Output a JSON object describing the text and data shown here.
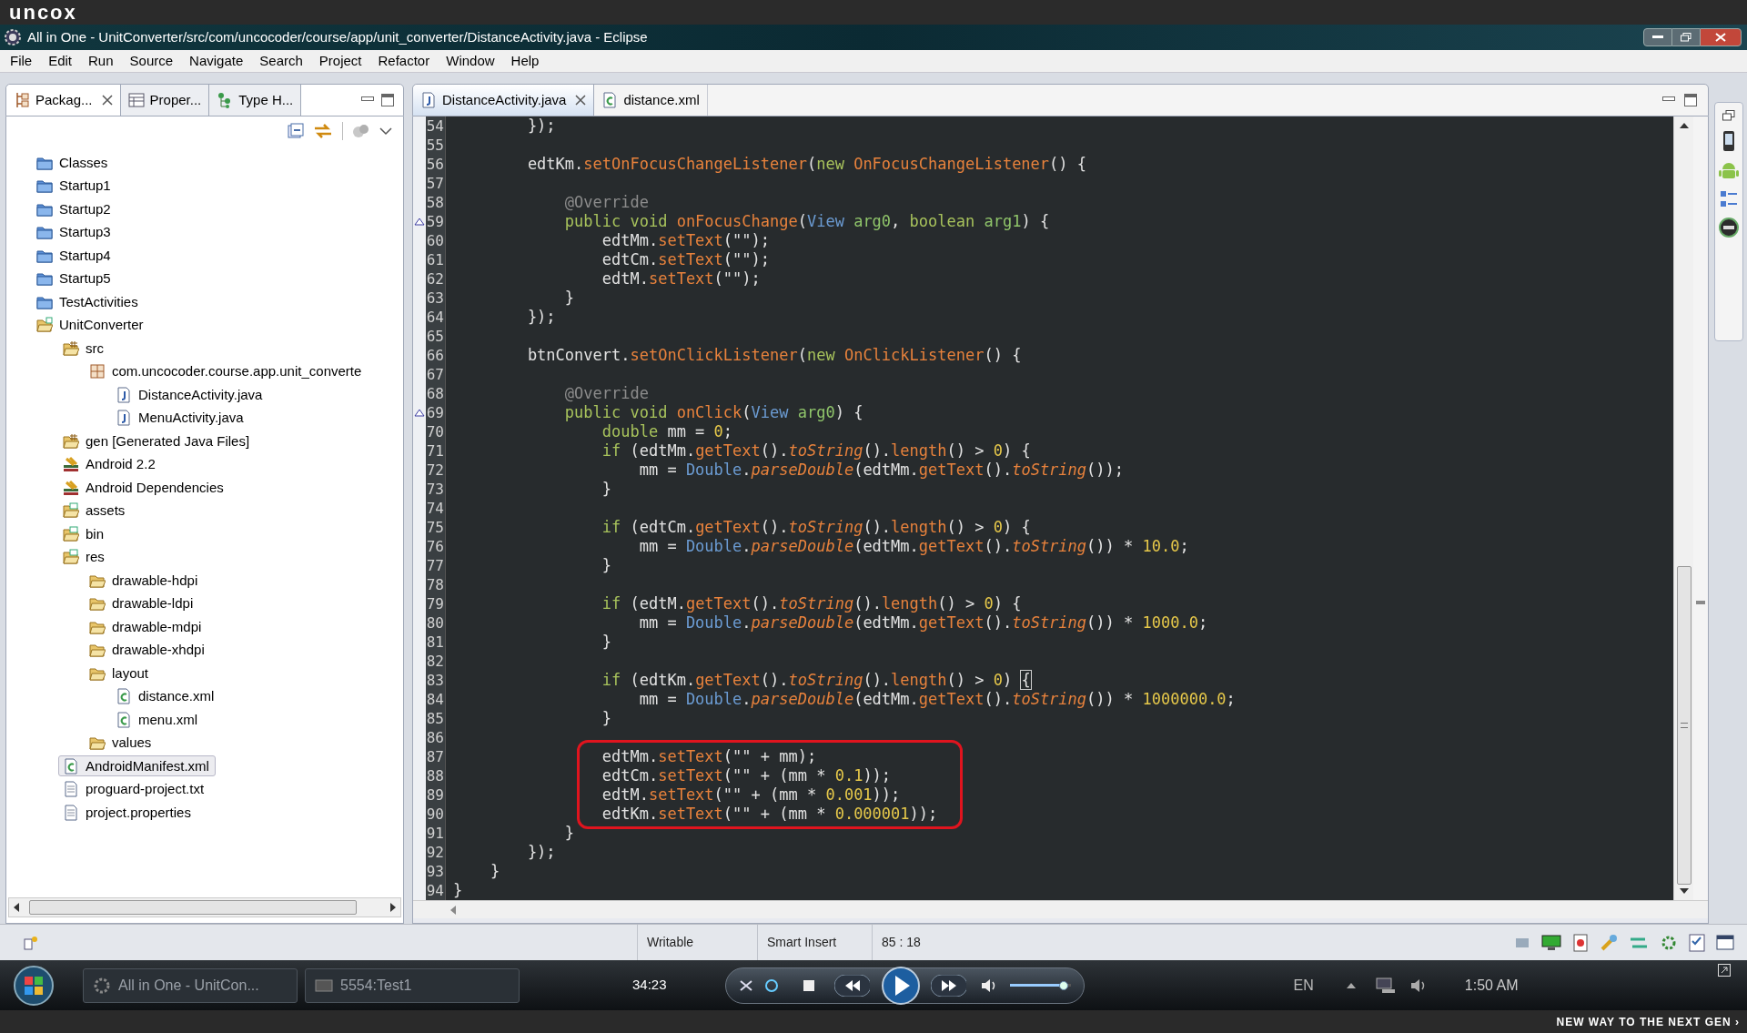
{
  "frame_logo": "uncox",
  "window": {
    "title": "All in One - UnitConverter/src/com/uncocoder/course/app/unit_converter/DistanceActivity.java - Eclipse"
  },
  "menu": [
    "File",
    "Edit",
    "Run",
    "Source",
    "Navigate",
    "Search",
    "Project",
    "Refactor",
    "Window",
    "Help"
  ],
  "view_tabs": [
    {
      "label": "Packag...",
      "kind": "package-explorer",
      "selected": true
    },
    {
      "label": "Proper...",
      "kind": "properties",
      "selected": false
    },
    {
      "label": "Type H...",
      "kind": "hierarchy",
      "selected": false
    }
  ],
  "tree": [
    {
      "label": "Classes",
      "kind": "project-closed",
      "selected": false
    },
    {
      "label": "Startup1",
      "kind": "project-closed",
      "selected": false
    },
    {
      "label": "Startup2",
      "kind": "project-closed",
      "selected": false
    },
    {
      "label": "Startup3",
      "kind": "project-closed",
      "selected": false
    },
    {
      "label": "Startup4",
      "kind": "project-closed",
      "selected": false
    },
    {
      "label": "Startup5",
      "kind": "project-closed",
      "selected": false
    },
    {
      "label": "TestActivities",
      "kind": "project-closed",
      "selected": false
    },
    {
      "label": "UnitConverter",
      "kind": "project-open",
      "selected": false,
      "children": [
        {
          "label": "src",
          "kind": "source-folder",
          "selected": false,
          "children": [
            {
              "label": "com.uncocoder.course.app.unit_converte",
              "kind": "package",
              "selected": false,
              "children": [
                {
                  "label": "DistanceActivity.java",
                  "kind": "java-file",
                  "selected": false
                },
                {
                  "label": "MenuActivity.java",
                  "kind": "java-file",
                  "selected": false
                }
              ]
            }
          ]
        },
        {
          "label": "gen [Generated Java Files]",
          "kind": "source-folder",
          "selected": false
        },
        {
          "label": "Android 2.2",
          "kind": "library",
          "selected": false
        },
        {
          "label": "Android Dependencies",
          "kind": "library",
          "selected": false
        },
        {
          "label": "assets",
          "kind": "resource-folder",
          "selected": false
        },
        {
          "label": "bin",
          "kind": "resource-folder",
          "selected": false
        },
        {
          "label": "res",
          "kind": "resource-folder",
          "selected": false,
          "children": [
            {
              "label": "drawable-hdpi",
              "kind": "folder",
              "selected": false
            },
            {
              "label": "drawable-ldpi",
              "kind": "folder",
              "selected": false
            },
            {
              "label": "drawable-mdpi",
              "kind": "folder",
              "selected": false
            },
            {
              "label": "drawable-xhdpi",
              "kind": "folder",
              "selected": false
            },
            {
              "label": "layout",
              "kind": "folder",
              "selected": false,
              "children": [
                {
                  "label": "distance.xml",
                  "kind": "xml-file",
                  "selected": false
                },
                {
                  "label": "menu.xml",
                  "kind": "xml-file",
                  "selected": false
                }
              ]
            },
            {
              "label": "values",
              "kind": "folder",
              "selected": false
            }
          ]
        },
        {
          "label": "AndroidManifest.xml",
          "kind": "xml-file",
          "selected": true
        },
        {
          "label": "proguard-project.txt",
          "kind": "text-file",
          "selected": false
        },
        {
          "label": "project.properties",
          "kind": "text-file",
          "selected": false
        }
      ]
    }
  ],
  "editor_tabs": [
    {
      "label": "DistanceActivity.java",
      "kind": "java-file",
      "selected": true
    },
    {
      "label": "distance.xml",
      "kind": "xml-file",
      "selected": false
    }
  ],
  "code_lines": [
    {
      "number": "54",
      "override_marker": false,
      "highlighted": false,
      "tokens": [
        {
          "kind": "plain",
          "text": "        });"
        }
      ]
    },
    {
      "number": "55",
      "override_marker": false,
      "highlighted": false
    },
    {
      "number": "56",
      "override_marker": false,
      "highlighted": false,
      "tokens": [
        {
          "kind": "plain",
          "text": "        edtKm."
        },
        {
          "kind": "method",
          "text": "setOnFocusChangeListener"
        },
        {
          "kind": "plain",
          "text": "("
        },
        {
          "kind": "keyword",
          "text": "new "
        },
        {
          "kind": "method",
          "text": "OnFocusChangeListener"
        },
        {
          "kind": "plain",
          "text": "() {"
        }
      ]
    },
    {
      "number": "57",
      "override_marker": false,
      "highlighted": false
    },
    {
      "number": "58",
      "override_marker": false,
      "highlighted": false,
      "tokens": [
        {
          "kind": "annotation",
          "text": "            @Override"
        }
      ]
    },
    {
      "number": "59",
      "override_marker": true,
      "highlighted": false,
      "tokens": [
        {
          "kind": "keyword",
          "text": "            public void "
        },
        {
          "kind": "method",
          "text": "onFocusChange"
        },
        {
          "kind": "plain",
          "text": "("
        },
        {
          "kind": "type",
          "text": "View"
        },
        {
          "kind": "param",
          "text": " arg0"
        },
        {
          "kind": "plain",
          "text": ", "
        },
        {
          "kind": "keyword",
          "text": "boolean"
        },
        {
          "kind": "param",
          "text": " arg1"
        },
        {
          "kind": "plain",
          "text": ") {"
        }
      ]
    },
    {
      "number": "60",
      "override_marker": false,
      "highlighted": false,
      "tokens": [
        {
          "kind": "plain",
          "text": "                edtMm."
        },
        {
          "kind": "method",
          "text": "setText"
        },
        {
          "kind": "plain",
          "text": "(\"\");"
        }
      ]
    },
    {
      "number": "61",
      "override_marker": false,
      "highlighted": false,
      "tokens": [
        {
          "kind": "plain",
          "text": "                edtCm."
        },
        {
          "kind": "method",
          "text": "setText"
        },
        {
          "kind": "plain",
          "text": "(\"\");"
        }
      ]
    },
    {
      "number": "62",
      "override_marker": false,
      "highlighted": false,
      "tokens": [
        {
          "kind": "plain",
          "text": "                edtM."
        },
        {
          "kind": "method",
          "text": "setText"
        },
        {
          "kind": "plain",
          "text": "(\"\");"
        }
      ]
    },
    {
      "number": "63",
      "override_marker": false,
      "highlighted": false,
      "tokens": [
        {
          "kind": "plain",
          "text": "            }"
        }
      ]
    },
    {
      "number": "64",
      "override_marker": false,
      "highlighted": false,
      "tokens": [
        {
          "kind": "plain",
          "text": "        });"
        }
      ]
    },
    {
      "number": "65",
      "override_marker": false,
      "highlighted": false
    },
    {
      "number": "66",
      "override_marker": false,
      "highlighted": false,
      "tokens": [
        {
          "kind": "plain",
          "text": "        btnConvert."
        },
        {
          "kind": "method",
          "text": "setOnClickListener"
        },
        {
          "kind": "plain",
          "text": "("
        },
        {
          "kind": "keyword",
          "text": "new "
        },
        {
          "kind": "method",
          "text": "OnClickListener"
        },
        {
          "kind": "plain",
          "text": "() {"
        }
      ]
    },
    {
      "number": "67",
      "override_marker": false,
      "highlighted": false
    },
    {
      "number": "68",
      "override_marker": false,
      "highlighted": false,
      "tokens": [
        {
          "kind": "annotation",
          "text": "            @Override"
        }
      ]
    },
    {
      "number": "69",
      "override_marker": true,
      "highlighted": false,
      "tokens": [
        {
          "kind": "keyword",
          "text": "            public void "
        },
        {
          "kind": "method",
          "text": "onClick"
        },
        {
          "kind": "plain",
          "text": "("
        },
        {
          "kind": "type",
          "text": "View"
        },
        {
          "kind": "param",
          "text": " arg0"
        },
        {
          "kind": "plain",
          "text": ") {"
        }
      ]
    },
    {
      "number": "70",
      "override_marker": false,
      "highlighted": false,
      "tokens": [
        {
          "kind": "keyword",
          "text": "                double"
        },
        {
          "kind": "plain",
          "text": " mm = "
        },
        {
          "kind": "number",
          "text": "0"
        },
        {
          "kind": "plain",
          "text": ";"
        }
      ]
    },
    {
      "number": "71",
      "override_marker": false,
      "highlighted": false,
      "tokens": [
        {
          "kind": "keyword",
          "text": "                if"
        },
        {
          "kind": "plain",
          "text": " (edtMm."
        },
        {
          "kind": "method",
          "text": "getText"
        },
        {
          "kind": "plain",
          "text": "()."
        },
        {
          "kind": "method-italic",
          "text": "toString"
        },
        {
          "kind": "plain",
          "text": "()."
        },
        {
          "kind": "method",
          "text": "length"
        },
        {
          "kind": "plain",
          "text": "() > "
        },
        {
          "kind": "number",
          "text": "0"
        },
        {
          "kind": "plain",
          "text": ") {"
        }
      ]
    },
    {
      "number": "72",
      "override_marker": false,
      "highlighted": false,
      "tokens": [
        {
          "kind": "plain",
          "text": "                    mm = "
        },
        {
          "kind": "type",
          "text": "Double"
        },
        {
          "kind": "plain",
          "text": "."
        },
        {
          "kind": "method-italic",
          "text": "parseDouble"
        },
        {
          "kind": "plain",
          "text": "(edtMm."
        },
        {
          "kind": "method",
          "text": "getText"
        },
        {
          "kind": "plain",
          "text": "()."
        },
        {
          "kind": "method-italic",
          "text": "toString"
        },
        {
          "kind": "plain",
          "text": "());"
        }
      ]
    },
    {
      "number": "73",
      "override_marker": false,
      "highlighted": false,
      "tokens": [
        {
          "kind": "plain",
          "text": "                }"
        }
      ]
    },
    {
      "number": "74",
      "override_marker": false,
      "highlighted": false
    },
    {
      "number": "75",
      "override_marker": false,
      "highlighted": false,
      "tokens": [
        {
          "kind": "keyword",
          "text": "                if"
        },
        {
          "kind": "plain",
          "text": " (edtCm."
        },
        {
          "kind": "method",
          "text": "getText"
        },
        {
          "kind": "plain",
          "text": "()."
        },
        {
          "kind": "method-italic",
          "text": "toString"
        },
        {
          "kind": "plain",
          "text": "()."
        },
        {
          "kind": "method",
          "text": "length"
        },
        {
          "kind": "plain",
          "text": "() > "
        },
        {
          "kind": "number",
          "text": "0"
        },
        {
          "kind": "plain",
          "text": ") {"
        }
      ]
    },
    {
      "number": "76",
      "override_marker": false,
      "highlighted": false,
      "tokens": [
        {
          "kind": "plain",
          "text": "                    mm = "
        },
        {
          "kind": "type",
          "text": "Double"
        },
        {
          "kind": "plain",
          "text": "."
        },
        {
          "kind": "method-italic",
          "text": "parseDouble"
        },
        {
          "kind": "plain",
          "text": "(edtMm."
        },
        {
          "kind": "method",
          "text": "getText"
        },
        {
          "kind": "plain",
          "text": "()."
        },
        {
          "kind": "method-italic",
          "text": "toString"
        },
        {
          "kind": "plain",
          "text": "()) * "
        },
        {
          "kind": "number",
          "text": "10.0"
        },
        {
          "kind": "plain",
          "text": ";"
        }
      ]
    },
    {
      "number": "77",
      "override_marker": false,
      "highlighted": false,
      "tokens": [
        {
          "kind": "plain",
          "text": "                }"
        }
      ]
    },
    {
      "number": "78",
      "override_marker": false,
      "highlighted": false
    },
    {
      "number": "79",
      "override_marker": false,
      "highlighted": false,
      "tokens": [
        {
          "kind": "keyword",
          "text": "                if"
        },
        {
          "kind": "plain",
          "text": " (edtM."
        },
        {
          "kind": "method",
          "text": "getText"
        },
        {
          "kind": "plain",
          "text": "()."
        },
        {
          "kind": "method-italic",
          "text": "toString"
        },
        {
          "kind": "plain",
          "text": "()."
        },
        {
          "kind": "method",
          "text": "length"
        },
        {
          "kind": "plain",
          "text": "() > "
        },
        {
          "kind": "number",
          "text": "0"
        },
        {
          "kind": "plain",
          "text": ") {"
        }
      ]
    },
    {
      "number": "80",
      "override_marker": false,
      "highlighted": false,
      "tokens": [
        {
          "kind": "plain",
          "text": "                    mm = "
        },
        {
          "kind": "type",
          "text": "Double"
        },
        {
          "kind": "plain",
          "text": "."
        },
        {
          "kind": "method-italic",
          "text": "parseDouble"
        },
        {
          "kind": "plain",
          "text": "(edtMm."
        },
        {
          "kind": "method",
          "text": "getText"
        },
        {
          "kind": "plain",
          "text": "()."
        },
        {
          "kind": "method-italic",
          "text": "toString"
        },
        {
          "kind": "plain",
          "text": "()) * "
        },
        {
          "kind": "number",
          "text": "1000.0"
        },
        {
          "kind": "plain",
          "text": ";"
        }
      ]
    },
    {
      "number": "81",
      "override_marker": false,
      "highlighted": false,
      "tokens": [
        {
          "kind": "plain",
          "text": "                }"
        }
      ]
    },
    {
      "number": "82",
      "override_marker": false,
      "highlighted": false
    },
    {
      "number": "83",
      "override_marker": false,
      "highlighted": false,
      "tokens": [
        {
          "kind": "keyword",
          "text": "                if"
        },
        {
          "kind": "plain",
          "text": " (edtKm."
        },
        {
          "kind": "method",
          "text": "getText"
        },
        {
          "kind": "plain",
          "text": "()."
        },
        {
          "kind": "method-italic",
          "text": "toString"
        },
        {
          "kind": "plain",
          "text": "()."
        },
        {
          "kind": "method",
          "text": "length"
        },
        {
          "kind": "plain",
          "text": "() > "
        },
        {
          "kind": "number",
          "text": "0"
        },
        {
          "kind": "plain",
          "text": ") "
        },
        {
          "kind": "matched-bracket",
          "text": "{"
        }
      ]
    },
    {
      "number": "84",
      "override_marker": false,
      "highlighted": false,
      "tokens": [
        {
          "kind": "plain",
          "text": "                    mm = "
        },
        {
          "kind": "type",
          "text": "Double"
        },
        {
          "kind": "plain",
          "text": "."
        },
        {
          "kind": "method-italic",
          "text": "parseDouble"
        },
        {
          "kind": "plain",
          "text": "(edtMm."
        },
        {
          "kind": "method",
          "text": "getText"
        },
        {
          "kind": "plain",
          "text": "()."
        },
        {
          "kind": "method-italic",
          "text": "toString"
        },
        {
          "kind": "plain",
          "text": "()) * "
        },
        {
          "kind": "number",
          "text": "1000000.0"
        },
        {
          "kind": "plain",
          "text": ";"
        }
      ]
    },
    {
      "number": "85",
      "override_marker": false,
      "highlighted": false,
      "tokens": [
        {
          "kind": "plain",
          "text": "                }"
        }
      ]
    },
    {
      "number": "86",
      "override_marker": false,
      "highlighted": false
    },
    {
      "number": "87",
      "override_marker": false,
      "highlighted": true,
      "tokens": [
        {
          "kind": "plain",
          "text": "                edtMm."
        },
        {
          "kind": "method",
          "text": "setText"
        },
        {
          "kind": "plain",
          "text": "(\"\" + mm);"
        }
      ]
    },
    {
      "number": "88",
      "override_marker": false,
      "highlighted": true,
      "tokens": [
        {
          "kind": "plain",
          "text": "                edtCm."
        },
        {
          "kind": "method",
          "text": "setText"
        },
        {
          "kind": "plain",
          "text": "(\"\" + (mm * "
        },
        {
          "kind": "number",
          "text": "0.1"
        },
        {
          "kind": "plain",
          "text": "));"
        }
      ]
    },
    {
      "number": "89",
      "override_marker": false,
      "highlighted": true,
      "tokens": [
        {
          "kind": "plain",
          "text": "                edtM."
        },
        {
          "kind": "method",
          "text": "setText"
        },
        {
          "kind": "plain",
          "text": "(\"\" + (mm * "
        },
        {
          "kind": "number",
          "text": "0.001"
        },
        {
          "kind": "plain",
          "text": "));"
        }
      ]
    },
    {
      "number": "90",
      "override_marker": false,
      "highlighted": true,
      "tokens": [
        {
          "kind": "plain",
          "text": "                edtKm."
        },
        {
          "kind": "method",
          "text": "setText"
        },
        {
          "kind": "plain",
          "text": "(\"\" + (mm * "
        },
        {
          "kind": "number",
          "text": "0.000001"
        },
        {
          "kind": "plain",
          "text": "));"
        }
      ]
    },
    {
      "number": "91",
      "override_marker": false,
      "highlighted": false,
      "tokens": [
        {
          "kind": "plain",
          "text": "            }"
        }
      ]
    },
    {
      "number": "92",
      "override_marker": false,
      "highlighted": false,
      "tokens": [
        {
          "kind": "plain",
          "text": "        });"
        }
      ]
    },
    {
      "number": "93",
      "override_marker": false,
      "highlighted": false,
      "tokens": [
        {
          "kind": "plain",
          "text": "    }"
        }
      ]
    },
    {
      "number": "94",
      "override_marker": false,
      "highlighted": false,
      "tokens": [
        {
          "kind": "plain",
          "text": "}"
        }
      ]
    }
  ],
  "status_bar": [
    "Writable",
    "Smart Insert",
    "85 : 18"
  ],
  "taskbar": {
    "buttons": [
      "All in One - UnitCon...",
      "5554:Test1"
    ],
    "language": "EN",
    "clock": "1:50 AM"
  },
  "player": {
    "time": "34:23",
    "volume": {
      "level": 0.88
    }
  },
  "frame_tagline": "NEW WAY TO THE NEXT GEN ›"
}
